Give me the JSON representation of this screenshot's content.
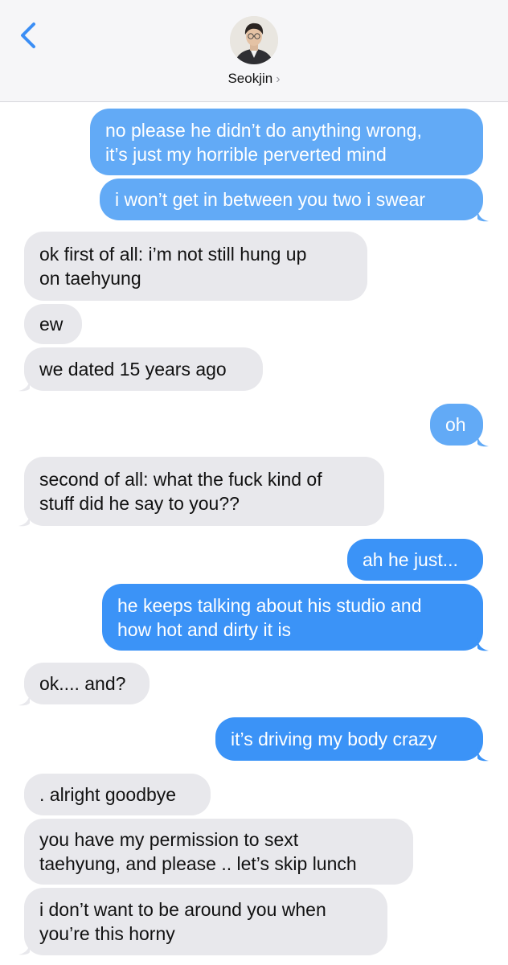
{
  "header": {
    "contact_name": "Seokjin",
    "chevron": "›",
    "back_icon": "chevron-left-icon",
    "accent": "#3b93f7"
  },
  "messages": [
    {
      "side": "sent",
      "lines": [
        "no please he didn’t do anything wrong,",
        "it’s just my horrible perverted mind"
      ]
    },
    {
      "side": "sent",
      "lines": [
        "i won’t get in between you two i swear"
      ]
    },
    {
      "side": "received",
      "lines": [
        "ok first of all: i’m not still hung up",
        "on taehyung"
      ]
    },
    {
      "side": "received",
      "lines": [
        "ew"
      ]
    },
    {
      "side": "received",
      "lines": [
        "we dated 15 years ago"
      ]
    },
    {
      "side": "sent",
      "lines": [
        "oh"
      ]
    },
    {
      "side": "received",
      "lines": [
        "second of all: what the fuck kind of",
        "stuff did he say to you??"
      ]
    },
    {
      "side": "sent",
      "lines": [
        "ah he just..."
      ]
    },
    {
      "side": "sent",
      "lines": [
        "he keeps talking about his studio and",
        "how hot and dirty it is"
      ]
    },
    {
      "side": "received",
      "lines": [
        "ok.... and?"
      ]
    },
    {
      "side": "sent",
      "lines": [
        "it’s driving my body crazy"
      ]
    },
    {
      "side": "received",
      "lines": [
        ". alright goodbye"
      ]
    },
    {
      "side": "received",
      "lines": [
        "you have my permission to sext",
        "taehyung, and please .. let’s skip lunch"
      ]
    },
    {
      "side": "received",
      "lines": [
        "i don’t want to be around you when",
        "you’re this horny"
      ]
    }
  ],
  "colors": {
    "sent_bubble": "#3b93f7",
    "sent_bubble_light": "#62aaf6",
    "received_bubble": "#e8e8ec",
    "header_bg": "#f6f6f8"
  }
}
